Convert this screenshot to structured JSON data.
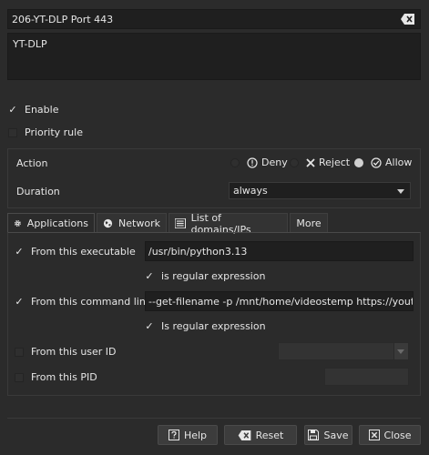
{
  "rule": {
    "name": "206-YT-DLP Port 443",
    "description": "YT-DLP"
  },
  "toggles": {
    "enable_label": "Enable",
    "enable_checked": true,
    "priority_label": "Priority rule",
    "priority_checked": false
  },
  "action": {
    "label": "Action",
    "options": [
      "Deny",
      "Reject",
      "Allow"
    ],
    "selected": "Allow"
  },
  "duration": {
    "label": "Duration",
    "value": "always"
  },
  "tabs": [
    {
      "label": "Applications",
      "icon": "gear-icon",
      "active": true
    },
    {
      "label": "Network",
      "icon": "globe-icon",
      "active": false
    },
    {
      "label": "List of domains/IPs",
      "icon": "list-icon",
      "active": false
    },
    {
      "label": "More",
      "icon": "",
      "active": false
    }
  ],
  "applications": {
    "executable_label": "From this executable",
    "executable_checked": true,
    "executable_value": "/usr/bin/python3.13",
    "executable_regex_label": "is regular expression",
    "executable_regex_checked": true,
    "cmdline_label": "From this command line",
    "cmdline_checked": true,
    "cmdline_value": "--get-filename -p /mnt/home/videostemp https://youtu.be/*",
    "cmdline_regex_label": "Is regular expression",
    "cmdline_regex_checked": true,
    "userid_label": "From this user ID",
    "userid_checked": false,
    "pid_label": "From this PID",
    "pid_checked": false
  },
  "buttons": {
    "help": "Help",
    "reset": "Reset",
    "save": "Save",
    "close": "Close"
  }
}
